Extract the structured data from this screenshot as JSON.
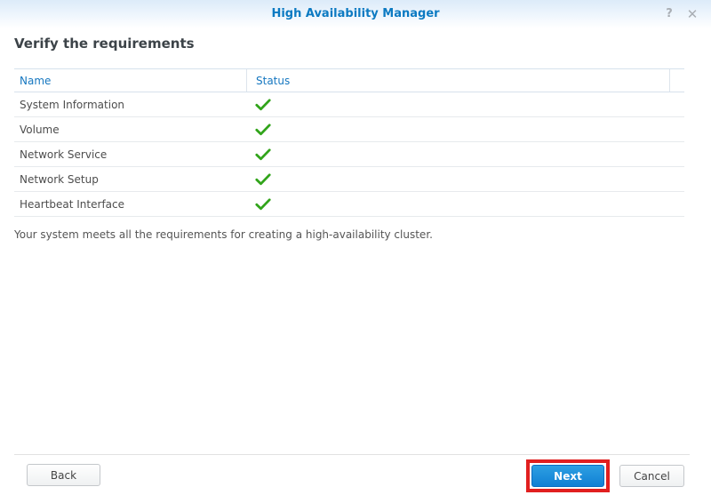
{
  "window": {
    "title": "High Availability Manager",
    "help_icon": "?",
    "close_icon": "✕"
  },
  "content": {
    "heading": "Verify the requirements",
    "message": "Your system meets all the requirements for creating a high-availability cluster."
  },
  "table": {
    "columns": [
      {
        "label": "Name"
      },
      {
        "label": "Status"
      }
    ],
    "rows": [
      {
        "name": "System Information",
        "status": "pass"
      },
      {
        "name": "Volume",
        "status": "pass"
      },
      {
        "name": "Network Service",
        "status": "pass"
      },
      {
        "name": "Network Setup",
        "status": "pass"
      },
      {
        "name": "Heartbeat Interface",
        "status": "pass"
      }
    ]
  },
  "footer": {
    "back_label": "Back",
    "next_label": "Next",
    "cancel_label": "Cancel"
  },
  "colors": {
    "title_blue": "#0c7ac2",
    "header_blue": "#1677c0",
    "check_green": "#31a41a",
    "next_top": "#2d9fe2",
    "next_bottom": "#1180d4",
    "annotation_red": "#e11f1f"
  }
}
